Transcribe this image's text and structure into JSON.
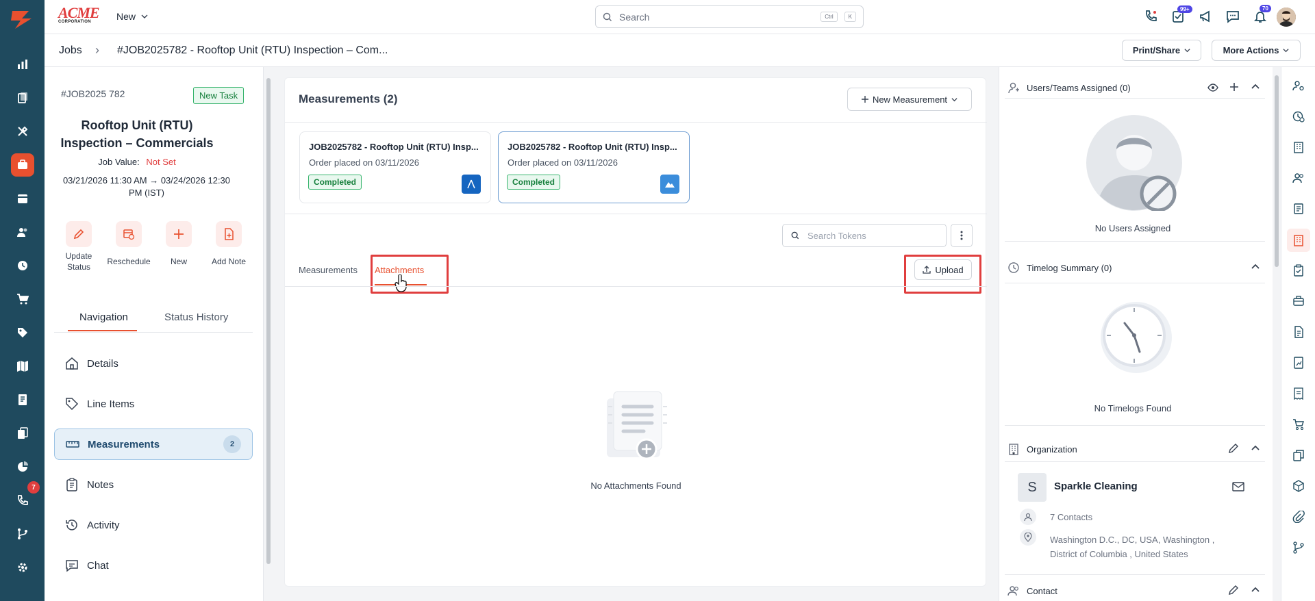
{
  "app": {
    "logo_text": "ACME",
    "logo_sub": "CORPORATION",
    "new_label": "New"
  },
  "search": {
    "placeholder": "Search",
    "shortcut_ctrl": "Ctrl",
    "shortcut_key": "K"
  },
  "header_badges": {
    "tasks": "99+",
    "notifications": "70"
  },
  "breadcrumb": {
    "parent": "Jobs",
    "separator": "›",
    "current": "#JOB2025782 - Rooftop Unit (RTU) Inspection – Com..."
  },
  "header_actions": {
    "print_share": "Print/Share",
    "more_actions": "More Actions"
  },
  "job": {
    "id": "#JOB2025 782",
    "status": "New Task",
    "title_line1": "Rooftop Unit (RTU)",
    "title_line2": "Inspection – Commercials",
    "value_label": "Job Value:",
    "value": "Not Set",
    "dates_line1": "03/21/2026 11:30 AM → 03/24/2026 12:30",
    "dates_line2": "PM (IST)"
  },
  "job_actions": [
    {
      "label_line1": "Update",
      "label_line2": "Status"
    },
    {
      "label_line1": "Reschedule",
      "label_line2": ""
    },
    {
      "label_line1": "New",
      "label_line2": ""
    },
    {
      "label_line1": "Add Note",
      "label_line2": ""
    }
  ],
  "left_tabs": {
    "navigation": "Navigation",
    "status_history": "Status History"
  },
  "nav_items": [
    {
      "label": "Details"
    },
    {
      "label": "Line Items"
    },
    {
      "label": "Measurements",
      "count": "2"
    },
    {
      "label": "Notes"
    },
    {
      "label": "Activity"
    },
    {
      "label": "Chat"
    }
  ],
  "left_rail_badge": "7",
  "measurements": {
    "title": "Measurements (2)",
    "new_button": "New Measurement",
    "cards": [
      {
        "title": "JOB2025782 - Rooftop Unit (RTU) Insp...",
        "subtitle": "Order placed on 03/11/2026",
        "status": "Completed"
      },
      {
        "title": "JOB2025782 - Rooftop Unit (RTU) Insp...",
        "subtitle": "Order placed on 03/11/2026",
        "status": "Completed"
      }
    ],
    "search_tokens_placeholder": "Search Tokens",
    "tabs": {
      "measurements": "Measurements",
      "attachments": "Attachments"
    },
    "upload_button": "Upload",
    "empty_text": "No Attachments Found"
  },
  "right_panel": {
    "users_title": "Users/Teams Assigned (0)",
    "no_users": "No Users Assigned",
    "timelog_title": "Timelog Summary (0)",
    "no_timelogs": "No Timelogs Found",
    "organization_title": "Organization",
    "org_initial": "S",
    "org_name": "Sparkle Cleaning",
    "contacts": "7 Contacts",
    "address_line1": "Washington D.C., DC, USA, Washington ,",
    "address_line2": "District of Columbia , United States",
    "contact_title": "Contact"
  },
  "colors": {
    "accent": "#e8502f",
    "sidebar": "#1f4a5e",
    "highlight": "#e03e3e",
    "success": "#34b36b"
  }
}
